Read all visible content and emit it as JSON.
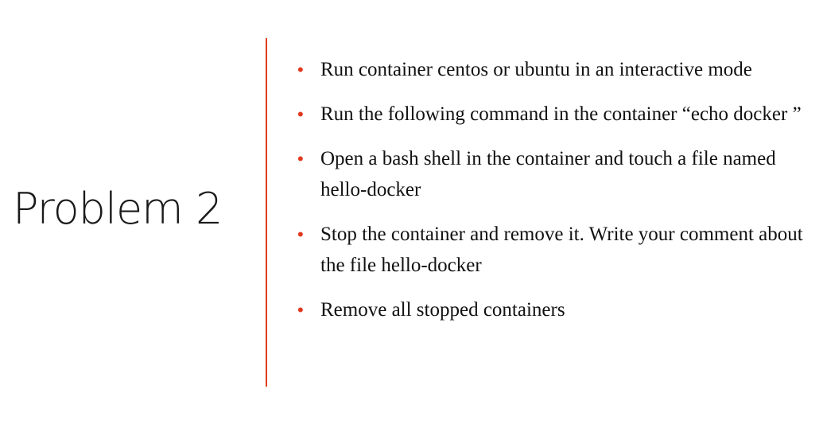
{
  "title": "Problem 2",
  "bullets": [
    "Run container centos or ubuntu in an interactive mode",
    "Run the following command in the container “echo docker ”",
    "Open a bash shell in the container and touch a file named hello-docker",
    "Stop the container and remove it. Write your comment about the file hello-docker",
    "Remove all stopped containers"
  ],
  "bullet_symbol": "•",
  "colors": {
    "accent": "#e23a1e",
    "text": "#111111",
    "background": "#ffffff"
  }
}
